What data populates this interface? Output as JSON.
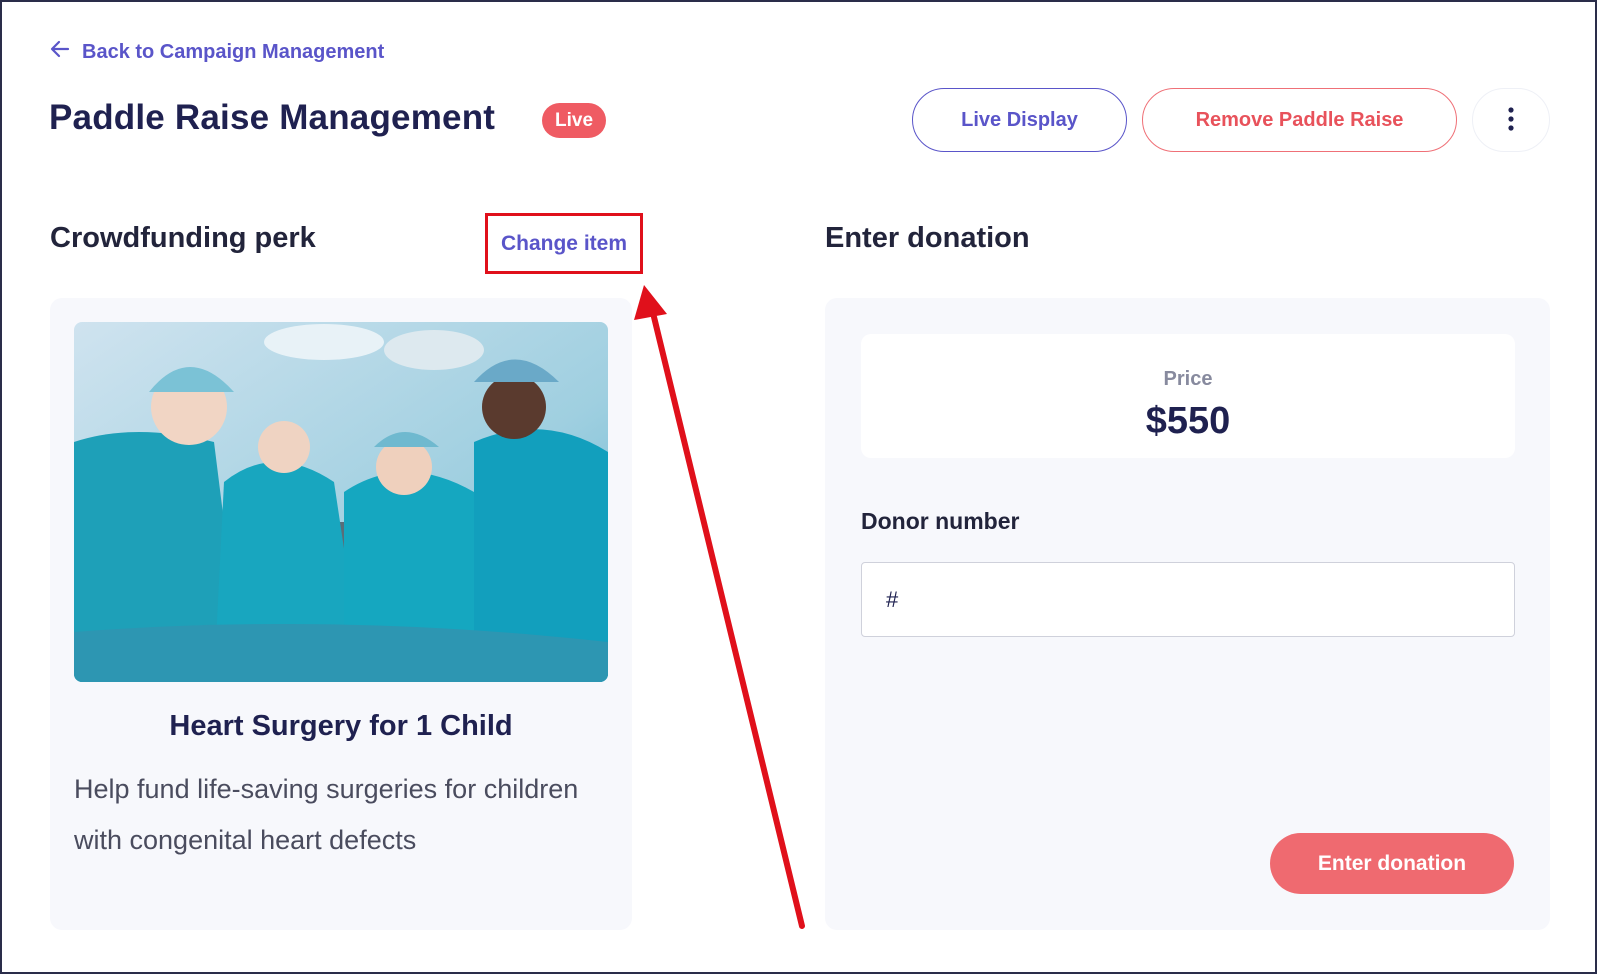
{
  "nav": {
    "back_label": "Back to Campaign Management"
  },
  "header": {
    "title": "Paddle Raise Management",
    "status_badge": "Live",
    "live_display_label": "Live Display",
    "remove_label": "Remove Paddle Raise"
  },
  "perk_section": {
    "heading": "Crowdfunding perk",
    "change_item_label": "Change item",
    "item": {
      "title": "Heart Surgery for 1 Child",
      "description": "Help fund life-saving surgeries for children with congenital heart defects"
    }
  },
  "donation_section": {
    "heading": "Enter donation",
    "price_label": "Price",
    "price_value": "$550",
    "donor_number_label": "Donor number",
    "donor_number_placeholder": "#",
    "donor_number_value": "",
    "submit_label": "Enter donation"
  },
  "colors": {
    "accent": "#5a55c9",
    "danger": "#ef5b63",
    "annotation": "#e0101b"
  }
}
